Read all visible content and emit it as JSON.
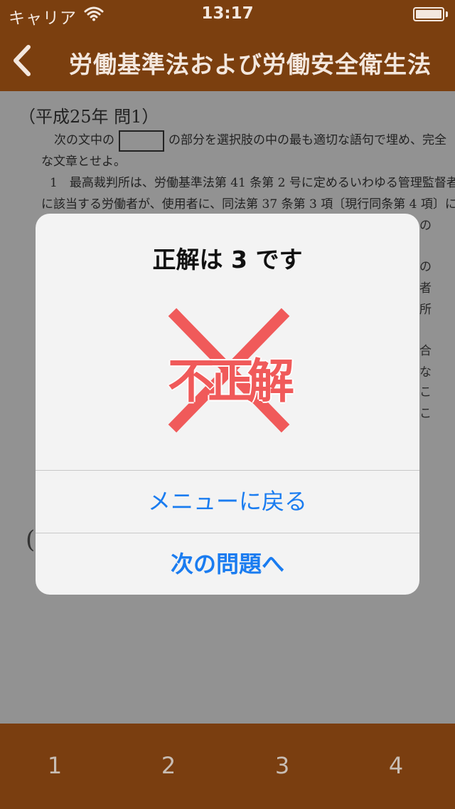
{
  "status_bar": {
    "carrier": "キャリア",
    "time": "13:17",
    "battery_level": 1.0
  },
  "nav": {
    "title": "労働基準法および労働安全衛生法",
    "back_icon": "chevron-left-icon"
  },
  "document": {
    "header": "（平成25年 問1）",
    "instruction_pre": "次の文中の",
    "instruction_post": "の部分を選択肢の中の最も適切な語句で埋め、完全",
    "instruction_line2": "な文章とせよ。",
    "item1_line1": "1　最高裁判所は、労働基準法第 41 条第 2 号に定めるいわゆる管理監督者",
    "item1_line2": "に該当する労働者が、使用者に、同法第 37 条第 3 項〔現行同条第 4 項〕に",
    "fragments": [
      "の",
      "の",
      "者",
      "所",
      "合",
      "な",
      "こ",
      "こ"
    ],
    "paren": "("
  },
  "alert": {
    "title": "正解は 3 です",
    "stamp_text": "不正解",
    "stamp_icon": "incorrect-cross-icon",
    "menu_button": "メニューに戻る",
    "next_button": "次の問題へ",
    "colors": {
      "stamp": "#f05a5a",
      "button": "#1a7cf0"
    }
  },
  "tabbar": {
    "tabs": [
      "1",
      "2",
      "3",
      "4"
    ]
  },
  "colors": {
    "brand": "#7b3f0f",
    "bar_text": "#f3e7de"
  }
}
